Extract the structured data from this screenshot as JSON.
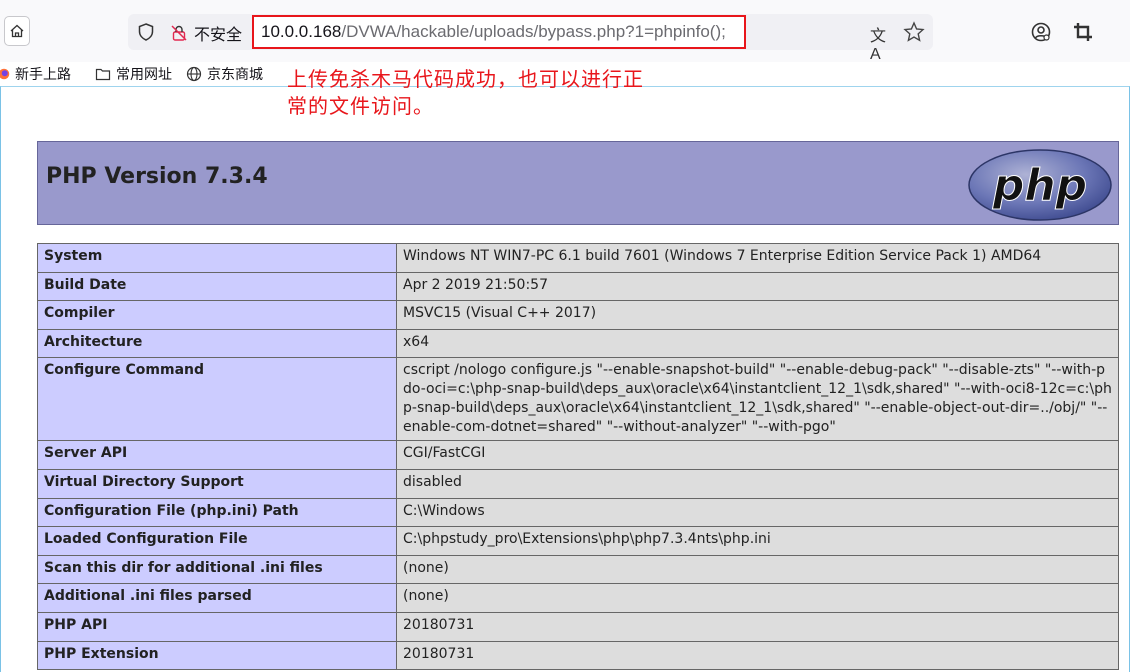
{
  "browser": {
    "security_label": "不安全",
    "url_host": "10.0.0.168",
    "url_path": "/DVWA/hackable/uploads/bypass.php?1=phpinfo();",
    "translate_glyph": "文A",
    "icons": [
      "home-icon",
      "shield-icon",
      "insecure-lock-icon",
      "translate-icon",
      "bookmark-star-icon",
      "account-icon",
      "crop-icon"
    ]
  },
  "bookmarks": [
    {
      "label": "新手上路",
      "icon": "firefox-icon"
    },
    {
      "label": "常用网址",
      "icon": "folder-icon"
    },
    {
      "label": "京东商城",
      "icon": "globe-icon"
    }
  ],
  "annotation": {
    "line1": "上传免杀木马代码成功，也可以进行正",
    "line2": "常的文件访问。",
    "color": "#e8161b"
  },
  "phpinfo": {
    "version_title": "PHP Version 7.3.4",
    "logo_text": "php",
    "rows": [
      {
        "key": "System",
        "value": "Windows NT WIN7-PC 6.1 build 7601 (Windows 7 Enterprise Edition Service Pack 1) AMD64"
      },
      {
        "key": "Build Date",
        "value": "Apr 2 2019 21:50:57"
      },
      {
        "key": "Compiler",
        "value": "MSVC15 (Visual C++ 2017)"
      },
      {
        "key": "Architecture",
        "value": "x64"
      },
      {
        "key": "Configure Command",
        "value": "cscript /nologo configure.js \"--enable-snapshot-build\" \"--enable-debug-pack\" \"--disable-zts\" \"--with-pdo-oci=c:\\php-snap-build\\deps_aux\\oracle\\x64\\instantclient_12_1\\sdk,shared\" \"--with-oci8-12c=c:\\php-snap-build\\deps_aux\\oracle\\x64\\instantclient_12_1\\sdk,shared\" \"--enable-object-out-dir=../obj/\" \"--enable-com-dotnet=shared\" \"--without-analyzer\" \"--with-pgo\""
      },
      {
        "key": "Server API",
        "value": "CGI/FastCGI"
      },
      {
        "key": "Virtual Directory Support",
        "value": "disabled"
      },
      {
        "key": "Configuration File (php.ini) Path",
        "value": "C:\\Windows"
      },
      {
        "key": "Loaded Configuration File",
        "value": "C:\\phpstudy_pro\\Extensions\\php\\php7.3.4nts\\php.ini"
      },
      {
        "key": "Scan this dir for additional .ini files",
        "value": "(none)"
      },
      {
        "key": "Additional .ini files parsed",
        "value": "(none)"
      },
      {
        "key": "PHP API",
        "value": "20180731"
      },
      {
        "key": "PHP Extension",
        "value": "20180731"
      }
    ],
    "colors": {
      "header_bg": "#9999cc",
      "key_bg": "#ccccff",
      "value_bg": "#dddddd"
    }
  }
}
